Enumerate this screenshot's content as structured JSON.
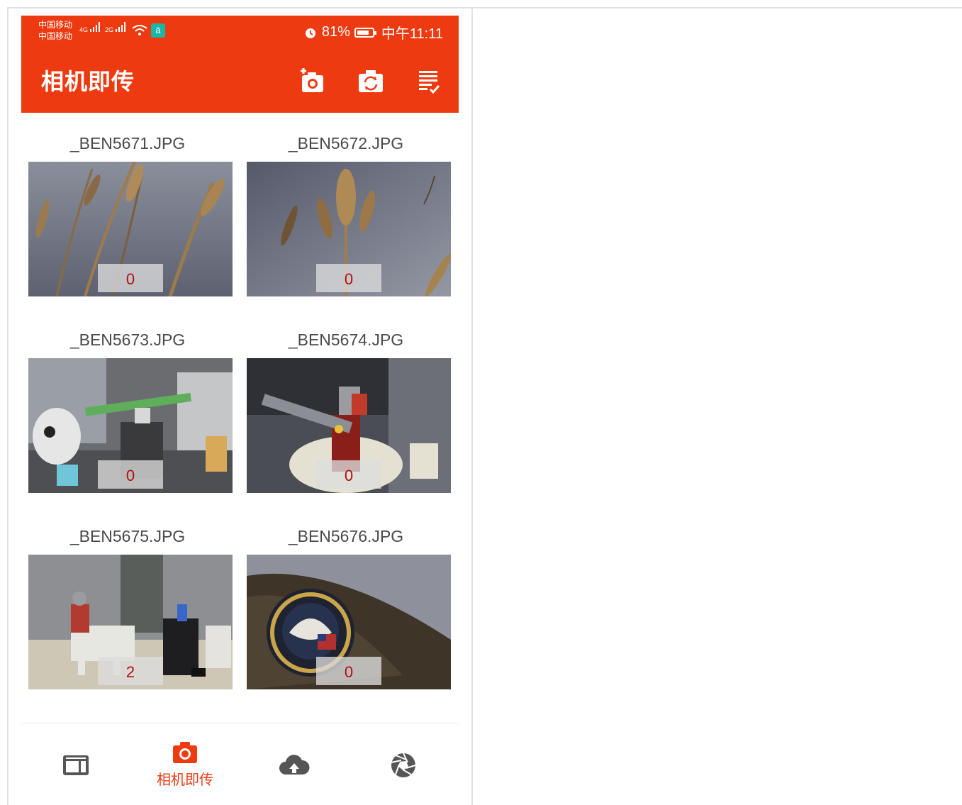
{
  "status_bar": {
    "carrier_1": "中国移动",
    "carrier_2": "中国移动",
    "net_1": "4G",
    "net_2": "2G",
    "battery_percent": "81%",
    "battery_level": 0.81,
    "time": "中午11:11"
  },
  "app_bar": {
    "title": "相机即传",
    "icons": [
      "add-camera-icon",
      "switch-camera-icon",
      "checklist-icon"
    ]
  },
  "photos": [
    {
      "name": "_BEN5671.JPG",
      "count": "0"
    },
    {
      "name": "_BEN5672.JPG",
      "count": "0"
    },
    {
      "name": "_BEN5673.JPG",
      "count": "0"
    },
    {
      "name": "_BEN5674.JPG",
      "count": "0"
    },
    {
      "name": "_BEN5675.JPG",
      "count": "2"
    },
    {
      "name": "_BEN5676.JPG",
      "count": "0"
    }
  ],
  "bottom_nav": {
    "active_label": "相机即传",
    "items": [
      "gallery-icon",
      "camera-icon",
      "cloud-upload-icon",
      "aperture-icon"
    ]
  },
  "colors": {
    "accent": "#ee3a10",
    "count_text": "#b01010"
  }
}
